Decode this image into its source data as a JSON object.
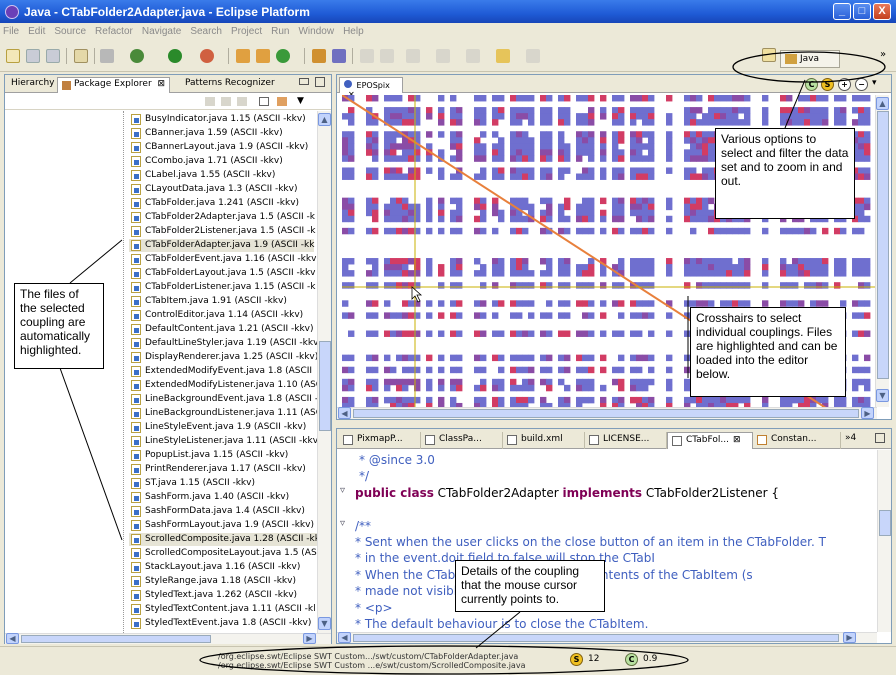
{
  "window": {
    "title": "Java - CTabFolder2Adapter.java - Eclipse Platform",
    "minimize": "_",
    "maximize": "□",
    "close": "X"
  },
  "menu": [
    "File",
    "Edit",
    "Source",
    "Refactor",
    "Navigate",
    "Search",
    "Project",
    "Run",
    "Window",
    "Help"
  ],
  "perspective": {
    "label": "Java",
    "more": "»"
  },
  "left_pane": {
    "tabs": [
      "Hierarchy",
      "Package Explorer",
      "Patterns Recognizer"
    ],
    "tab_close": "⊠",
    "files": [
      "BusyIndicator.java 1.15 (ASCII -kkv)",
      "CBanner.java 1.59 (ASCII -kkv)",
      "CBannerLayout.java 1.9 (ASCII -kkv)",
      "CCombo.java 1.71 (ASCII -kkv)",
      "CLabel.java 1.55 (ASCII -kkv)",
      "CLayoutData.java 1.3 (ASCII -kkv)",
      "CTabFolder.java 1.241 (ASCII -kkv)",
      "CTabFolder2Adapter.java 1.5 (ASCII -k",
      "CTabFolder2Listener.java 1.5 (ASCII -k",
      "CTabFolderAdapter.java 1.9 (ASCII -kk",
      "CTabFolderEvent.java 1.16 (ASCII -kkv",
      "CTabFolderLayout.java 1.5 (ASCII -kkv",
      "CTabFolderListener.java 1.15 (ASCII -k",
      "CTabItem.java 1.91 (ASCII -kkv)",
      "ControlEditor.java 1.14 (ASCII -kkv)",
      "DefaultContent.java 1.21 (ASCII -kkv)",
      "DefaultLineStyler.java 1.19 (ASCII -kkv",
      "DisplayRenderer.java 1.25 (ASCII -kkv)",
      "ExtendedModifyEvent.java 1.8 (ASCII",
      "ExtendedModifyListener.java 1.10 (ASC",
      "LineBackgroundEvent.java 1.8 (ASCII -",
      "LineBackgroundListener.java 1.11 (ASC",
      "LineStyleEvent.java 1.9 (ASCII -kkv)",
      "LineStyleListener.java 1.11 (ASCII -kkv",
      "PopupList.java 1.15 (ASCII -kkv)",
      "PrintRenderer.java 1.17 (ASCII -kkv)",
      "ST.java 1.15 (ASCII -kkv)",
      "SashForm.java 1.40 (ASCII -kkv)",
      "SashFormData.java 1.4 (ASCII -kkv)",
      "SashFormLayout.java 1.9 (ASCII -kkv)",
      "ScrolledComposite.java 1.28 (ASCII -kk",
      "ScrolledCompositeLayout.java 1.5 (ASC",
      "StackLayout.java 1.16 (ASCII -kkv)",
      "StyleRange.java 1.18 (ASCII -kkv)",
      "StyledText.java 1.262 (ASCII -kkv)",
      "StyledTextContent.java 1.11 (ASCII -kl",
      "StyledTextEvent.java 1.8 (ASCII -kkv)"
    ],
    "highlighted": [
      9,
      30
    ]
  },
  "matrix_pane": {
    "tab": "EPOSpix",
    "tab_close": "✕",
    "options": [
      "C",
      "S",
      "+",
      "−",
      "▾"
    ]
  },
  "editor": {
    "tabs": [
      "PixmapP...",
      "ClassPa...",
      "build.xml",
      "LICENSE...",
      "CTabFol...",
      "Constan..."
    ],
    "overflow": "»4",
    "lines": [
      {
        "kind": "comment",
        "text": " * @since 3.0"
      },
      {
        "kind": "comment",
        "text": " */"
      },
      {
        "kind": "decl",
        "pre": "public class",
        "mid": " CTabFolder2Adapter ",
        "kw2": "implements",
        "post": " CTabFolder2Listener {"
      },
      {
        "kind": "blank",
        "text": ""
      },
      {
        "kind": "comment",
        "text": "/**"
      },
      {
        "kind": "comment",
        "text": " * Sent when the user clicks on the close button of an item in the CTabFolder.  T"
      },
      {
        "kind": "comment",
        "text": " * in the event.doit field to false will stop  the CTabI"
      },
      {
        "kind": "comment",
        "text": " * When the CTabItem is disposed.  The contents of the CTabItem (s"
      },
      {
        "kind": "comment",
        "text": " * made not visible when it is closed."
      },
      {
        "kind": "comment",
        "text": " * <p>"
      },
      {
        "kind": "comment",
        "text": " * The default behaviour is to close the CTabItem."
      }
    ]
  },
  "status": {
    "path1": "/org.eclipse.swt/Eclipse SWT Custom.../swt/custom/CTabFolderAdapter.java",
    "path2": "/org.eclipse.swt/Eclipse SWT Custom ...e/swt/custom/ScrolledComposite.java",
    "s_icon": "S",
    "s_value": "12",
    "c_icon": "C",
    "c_value": "0.9"
  },
  "callouts": {
    "options": "Various options to select and filter the data set and to zoom in and out.",
    "files": "The files of the selected coupling are automatically highlighted.",
    "crosshairs": "Crosshairs to select individual couplings. Files are highlighted and can be loaded into the editor below.",
    "details": "Details of the coupling that the mouse cursor currently points to."
  },
  "colors": {
    "matrix_blue": "#6f6fcf",
    "matrix_red": "#d23c64",
    "matrix_purple": "#8a4ca6",
    "crosshair": "#c8b000"
  }
}
